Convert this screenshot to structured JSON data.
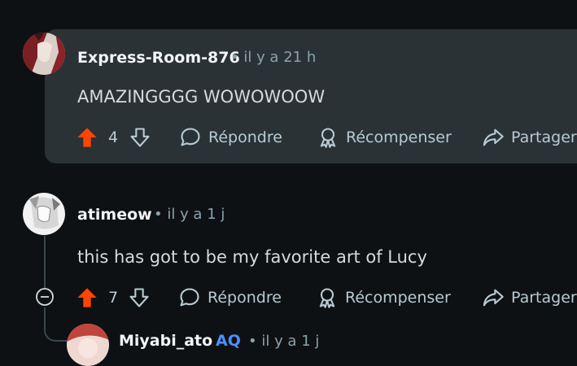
{
  "comments": [
    {
      "username": "Express-Room-876",
      "time": "• il y a 21 h",
      "text": "AMAZINGGGG WOWOWOOW",
      "upvotes": "4",
      "reply_label": "Répondre",
      "award_label": "Récompenser",
      "share_label": "Partager"
    },
    {
      "username": "atimeow",
      "time": "• il y a 1 j",
      "text": "this has got to be my favorite art of Lucy",
      "upvotes": "7",
      "reply_label": "Répondre",
      "award_label": "Récompenser",
      "share_label": "Partager"
    }
  ],
  "partial_reply": {
    "username": "Miyabi_ato",
    "badge": "AQ",
    "time": "• il y a 1 j"
  },
  "colors": {
    "upvote_active": "#ff4500",
    "panel": "#2a3236",
    "background": "#0e1113"
  }
}
